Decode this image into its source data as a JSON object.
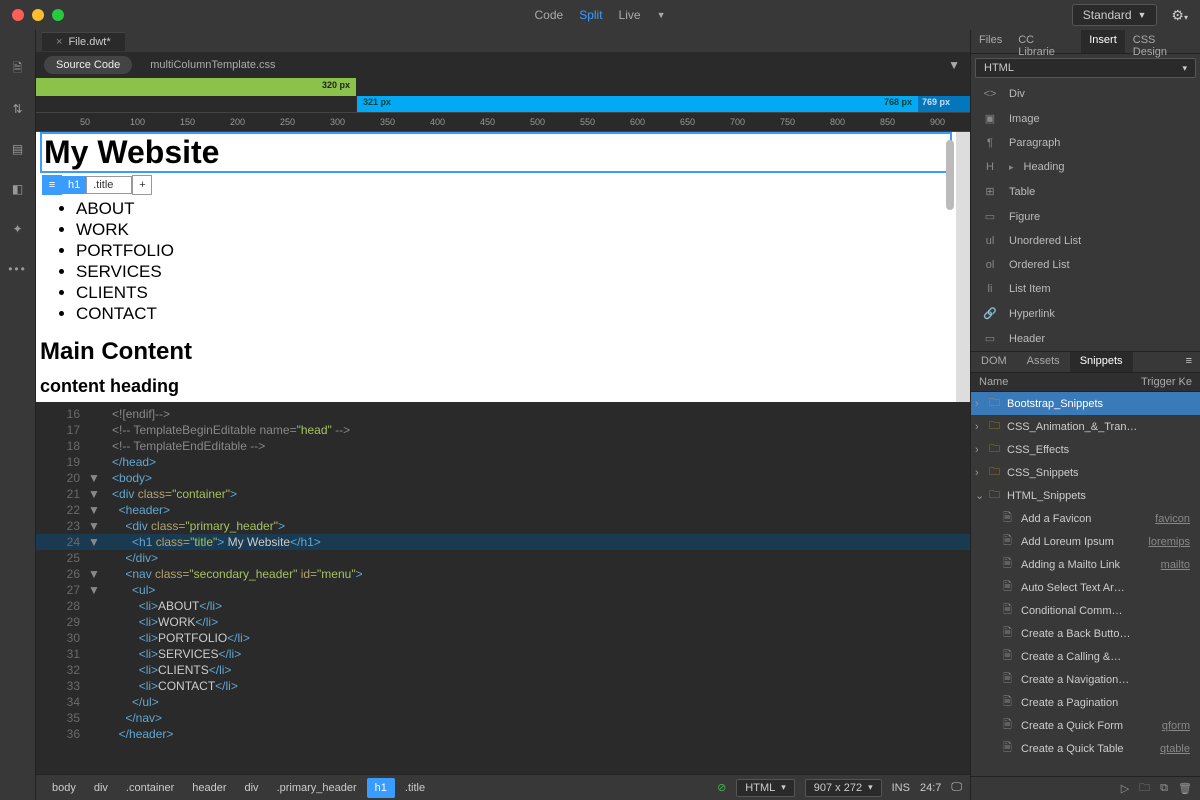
{
  "titlebar": {
    "view_modes": [
      "Code",
      "Split",
      "Live"
    ],
    "view_active": "Split",
    "layout_label": "Standard"
  },
  "file_tab": {
    "name": "File.dwt*"
  },
  "source_row": {
    "button": "Source Code",
    "related": "multiColumnTemplate.css"
  },
  "media_queries": {
    "green_label": "320  px",
    "blue_left": "321  px",
    "blue_right": "768  px",
    "dark_label": "769  px"
  },
  "ruler_ticks": [
    "50",
    "100",
    "150",
    "200",
    "250",
    "300",
    "350",
    "400",
    "450",
    "500",
    "550",
    "600",
    "650",
    "700",
    "750",
    "800",
    "850",
    "900"
  ],
  "live": {
    "h1": "My Website",
    "hud_tag": "h1",
    "hud_class": ".title",
    "nav": [
      "ABOUT",
      "WORK",
      "PORTFOLIO",
      "SERVICES",
      "CLIENTS",
      "CONTACT"
    ],
    "h2": "Main Content",
    "h3": "content heading"
  },
  "code_lines": [
    {
      "n": 16,
      "f": "",
      "html": "<span class='c-comment'>&lt;![endif]--&gt;</span>"
    },
    {
      "n": 17,
      "f": "",
      "html": "<span class='c-comment'>&lt;!-- TemplateBeginEditable name=</span><span class='c-str'>\"head\"</span><span class='c-comment'> --&gt;</span>"
    },
    {
      "n": 18,
      "f": "",
      "html": "<span class='c-comment'>&lt;!-- TemplateEndEditable --&gt;</span>"
    },
    {
      "n": 19,
      "f": "",
      "html": "<span class='c-tag'>&lt;/head&gt;</span>"
    },
    {
      "n": 20,
      "f": "▼",
      "html": "<span class='c-tag'>&lt;body&gt;</span>"
    },
    {
      "n": 21,
      "f": "▼",
      "html": "<span class='c-tag'>&lt;div</span> <span class='c-attr'>class=</span><span class='c-str'>\"container\"</span><span class='c-tag'>&gt;</span>"
    },
    {
      "n": 22,
      "f": "▼",
      "html": "  <span class='c-tag'>&lt;header&gt;</span>"
    },
    {
      "n": 23,
      "f": "▼",
      "html": "    <span class='c-tag'>&lt;div</span> <span class='c-attr'>class=</span><span class='c-str'>\"primary_header\"</span><span class='c-tag'>&gt;</span>"
    },
    {
      "n": 24,
      "f": "▼",
      "hl": true,
      "html": "      <span class='c-tag'>&lt;h1</span> <span class='c-attr'>class=</span><span class='c-str'>\"title\"</span><span class='c-tag'>&gt;</span> <span class='c-text'>My Website</span><span class='c-tag'>&lt;/h1&gt;</span>"
    },
    {
      "n": 25,
      "f": "",
      "html": "    <span class='c-tag'>&lt;/div&gt;</span>"
    },
    {
      "n": 26,
      "f": "▼",
      "html": "    <span class='c-tag'>&lt;nav</span> <span class='c-attr'>class=</span><span class='c-str'>\"secondary_header\"</span> <span class='c-attr'>id=</span><span class='c-str'>\"menu\"</span><span class='c-tag'>&gt;</span>"
    },
    {
      "n": 27,
      "f": "▼",
      "html": "      <span class='c-tag'>&lt;ul&gt;</span>"
    },
    {
      "n": 28,
      "f": "",
      "html": "        <span class='c-tag'>&lt;li&gt;</span><span class='c-text'>ABOUT</span><span class='c-tag'>&lt;/li&gt;</span>"
    },
    {
      "n": 29,
      "f": "",
      "html": "        <span class='c-tag'>&lt;li&gt;</span><span class='c-text'>WORK</span><span class='c-tag'>&lt;/li&gt;</span>"
    },
    {
      "n": 30,
      "f": "",
      "html": "        <span class='c-tag'>&lt;li&gt;</span><span class='c-text'>PORTFOLIO</span><span class='c-tag'>&lt;/li&gt;</span>"
    },
    {
      "n": 31,
      "f": "",
      "html": "        <span class='c-tag'>&lt;li&gt;</span><span class='c-text'>SERVICES</span><span class='c-tag'>&lt;/li&gt;</span>"
    },
    {
      "n": 32,
      "f": "",
      "html": "        <span class='c-tag'>&lt;li&gt;</span><span class='c-text'>CLIENTS</span><span class='c-tag'>&lt;/li&gt;</span>"
    },
    {
      "n": 33,
      "f": "",
      "html": "        <span class='c-tag'>&lt;li&gt;</span><span class='c-text'>CONTACT</span><span class='c-tag'>&lt;/li&gt;</span>"
    },
    {
      "n": 34,
      "f": "",
      "html": "      <span class='c-tag'>&lt;/ul&gt;</span>"
    },
    {
      "n": 35,
      "f": "",
      "html": "    <span class='c-tag'>&lt;/nav&gt;</span>"
    },
    {
      "n": 36,
      "f": "",
      "html": "  <span class='c-tag'>&lt;/header&gt;</span>"
    }
  ],
  "statusbar": {
    "crumbs": [
      "body",
      "div",
      ".container",
      "header",
      "div",
      ".primary_header",
      "h1",
      ".title"
    ],
    "crumb_selected": 6,
    "lang": "HTML",
    "size": "907 x 272",
    "ins": "INS",
    "pos": "24:7"
  },
  "right": {
    "tabs": [
      "Files",
      "CC Librarie",
      "Insert",
      "CSS Design"
    ],
    "tabs_active": "Insert",
    "dropdown": "HTML",
    "items": [
      {
        "icon": "<>",
        "label": "Div"
      },
      {
        "icon": "▣",
        "label": "Image"
      },
      {
        "icon": "¶",
        "label": "Paragraph"
      },
      {
        "icon": "H",
        "label": "Heading",
        "sub": true
      },
      {
        "icon": "⊞",
        "label": "Table"
      },
      {
        "icon": "▭",
        "label": "Figure"
      },
      {
        "icon": "ul",
        "label": "Unordered List"
      },
      {
        "icon": "ol",
        "label": "Ordered List"
      },
      {
        "icon": "li",
        "label": "List Item"
      },
      {
        "icon": "🔗",
        "label": "Hyperlink"
      },
      {
        "icon": "▭",
        "label": "Header"
      }
    ]
  },
  "bottom_panel": {
    "tabs": [
      "DOM",
      "Assets",
      "Snippets"
    ],
    "active": "Snippets",
    "cols": [
      "Name",
      "Trigger Ke"
    ],
    "tree": [
      {
        "t": "folder",
        "arrow": "›",
        "label": "Bootstrap_Snippets",
        "sel": true,
        "indent": 0
      },
      {
        "t": "folder",
        "arrow": "›",
        "label": "CSS_Animation_&_Tran…",
        "indent": 0
      },
      {
        "t": "folder",
        "arrow": "›",
        "label": "CSS_Effects",
        "indent": 0
      },
      {
        "t": "folder",
        "arrow": "›",
        "label": "CSS_Snippets",
        "indent": 0
      },
      {
        "t": "folder",
        "arrow": "⌄",
        "label": "HTML_Snippets",
        "indent": 0
      },
      {
        "t": "file",
        "label": "Add a Favicon",
        "trig": "favicon",
        "indent": 1
      },
      {
        "t": "file",
        "label": "Add Loreum Ipsum",
        "trig": "loremips",
        "indent": 1
      },
      {
        "t": "file",
        "label": "Adding a Mailto Link",
        "trig": "mailto",
        "indent": 1
      },
      {
        "t": "file",
        "label": "Auto Select Text Ar…",
        "indent": 1
      },
      {
        "t": "file",
        "label": "Conditional Comm…",
        "indent": 1
      },
      {
        "t": "file",
        "label": "Create a Back Butto…",
        "indent": 1
      },
      {
        "t": "file",
        "label": "Create a Calling &…",
        "indent": 1
      },
      {
        "t": "file",
        "label": "Create a Navigation…",
        "indent": 1
      },
      {
        "t": "file",
        "label": "Create a Pagination",
        "indent": 1
      },
      {
        "t": "file",
        "label": "Create a Quick Form",
        "trig": "qform",
        "indent": 1
      },
      {
        "t": "file",
        "label": "Create a Quick Table",
        "trig": "qtable",
        "indent": 1
      }
    ]
  }
}
